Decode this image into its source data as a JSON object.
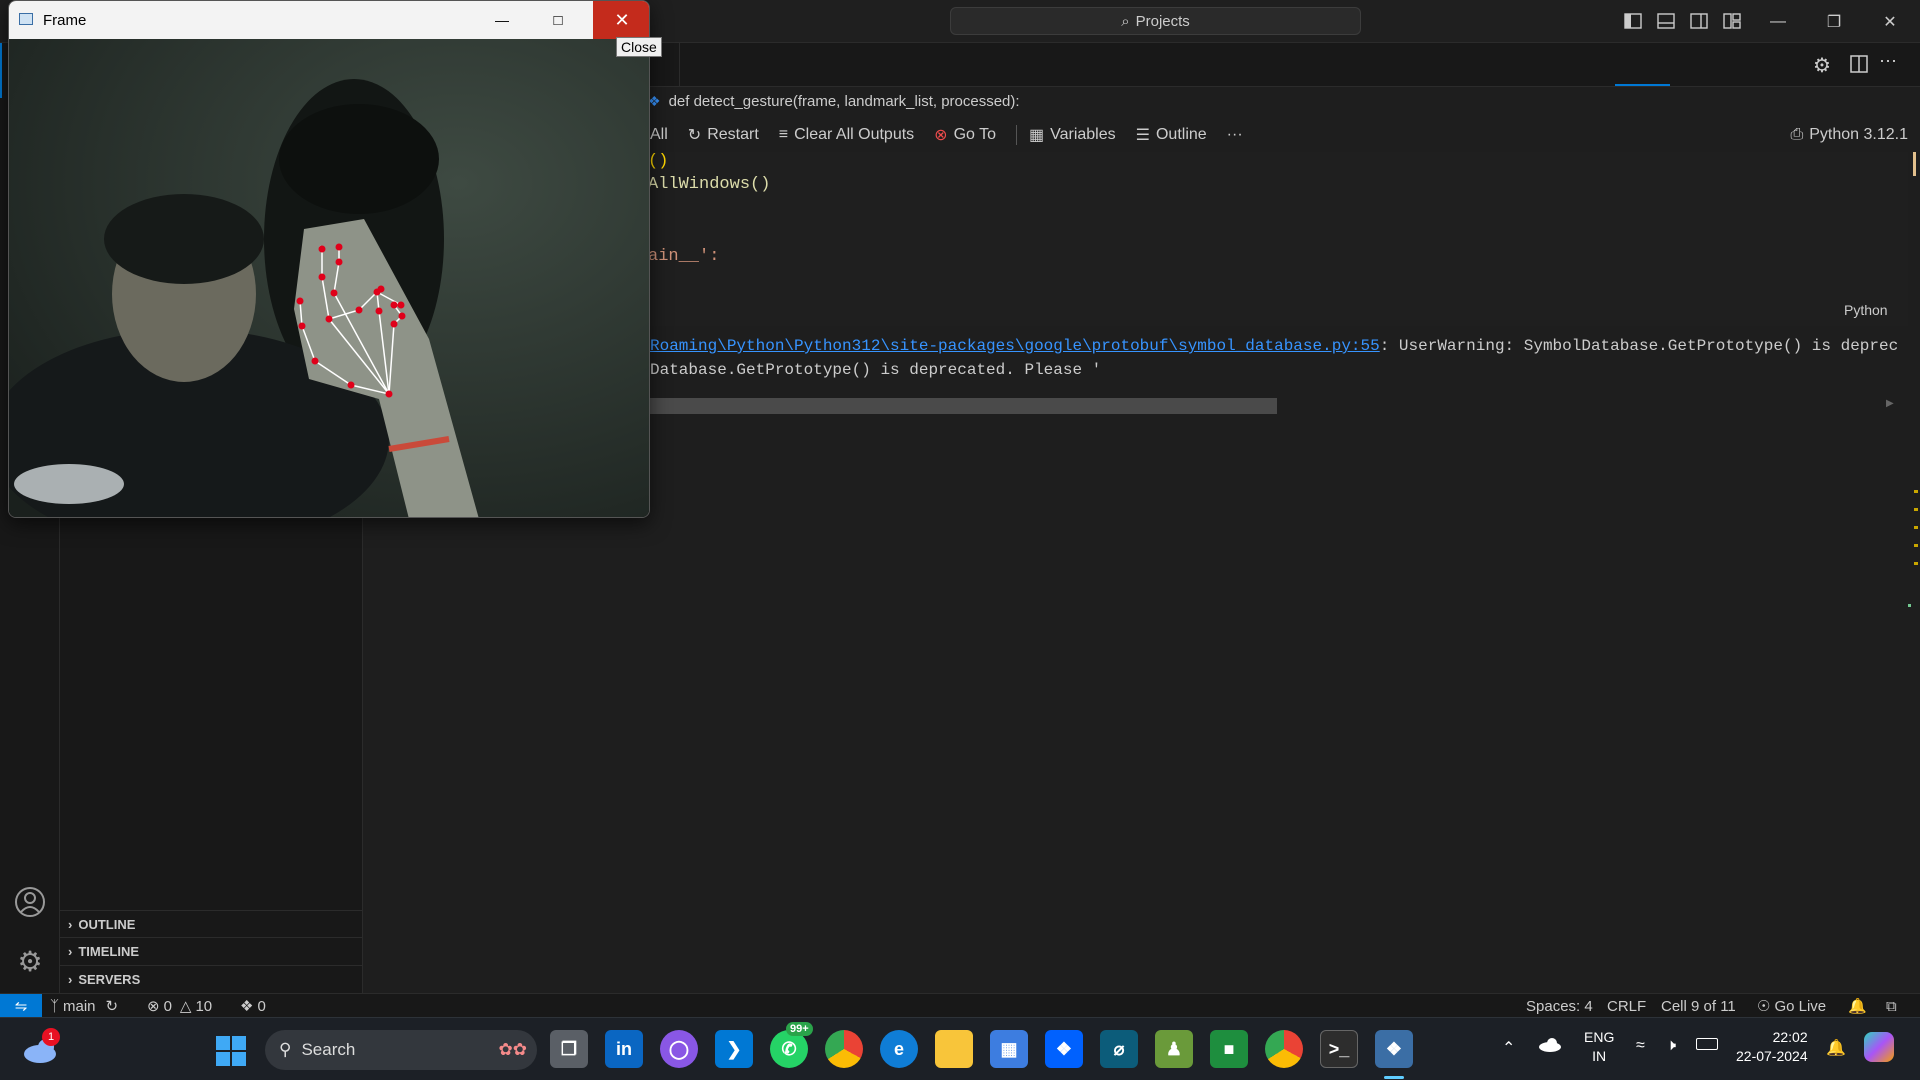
{
  "titlebar": {
    "search_label": "Projects"
  },
  "frame_window": {
    "title": "Frame",
    "close_tooltip": "Close"
  },
  "breadcrumb": {
    "function_signature": "def detect_gesture(frame, landmark_list, processed):"
  },
  "notebook_toolbar": {
    "run_all": "All",
    "restart": "Restart",
    "clear_outputs": "Clear All Outputs",
    "goto": "Go To",
    "variables": "Variables",
    "outline": "Outline",
    "more": "···",
    "kernel": "Python 3.12.1"
  },
  "code": {
    "line1": "()",
    "line2": "AllWindows()",
    "line3": "ain__':",
    "language": "Python"
  },
  "output": {
    "link": "Roaming\\Python\\Python312\\site-packages\\google\\protobuf\\symbol_database.py:55",
    "warning": ": UserWarning: SymbolDatabase.GetPrototype() is deprec",
    "line2": "Database.GetPrototype() is deprecated. Please '"
  },
  "sidebar_sections": {
    "outline": "OUTLINE",
    "timeline": "TIMELINE",
    "servers": "SERVERS"
  },
  "statusbar": {
    "branch": "main",
    "errors": "0",
    "warnings": "10",
    "ports": "0",
    "spaces": "Spaces: 4",
    "eol": "CRLF",
    "cell": "Cell 9 of 11",
    "golive": "Go Live"
  },
  "taskbar": {
    "search": "Search",
    "whatsapp_badge": "99+",
    "weather_badge": "1",
    "lang_top": "ENG",
    "lang_bottom": "IN",
    "time": "22:02",
    "date": "22-07-2024"
  },
  "colors": {
    "accent": "#0078d4",
    "close_red": "#c42b1c",
    "link": "#3794ff",
    "landmark": "#e0001a",
    "string": "#ce9178",
    "bracket": "#ffd700"
  }
}
